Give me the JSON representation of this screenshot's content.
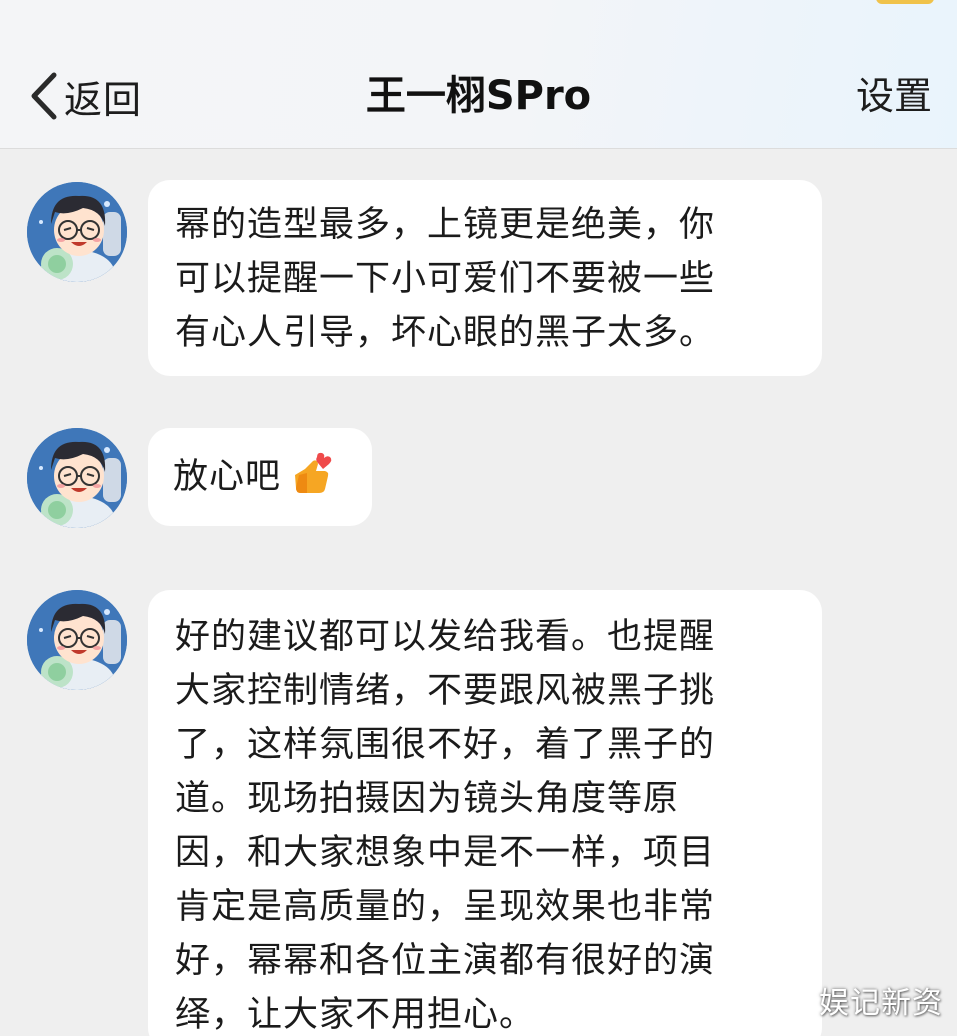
{
  "header": {
    "back_label": "返回",
    "title": "王一栩SPro",
    "settings_label": "设置"
  },
  "messages": [
    {
      "sender": "avatar",
      "text": "幂的造型最多，上镜更是绝美，你\n可以提醒一下小可爱们不要被一些\n有心人引导，坏心眼的黑子太多。"
    },
    {
      "sender": "avatar",
      "text": "放心吧",
      "emoji": "heart-thumbs-up-emoji-icon"
    },
    {
      "sender": "avatar",
      "text": "好的建议都可以发给我看。也提醒\n大家控制情绪，不要跟风被黑子挑\n了，这样氛围很不好，着了黑子的\n道。现场拍摄因为镜头角度等原\n因，和大家想象中是不一样，项目\n肯定是高质量的，呈现效果也非常\n好，幂幂和各位主演都有很好的演\n绎，让大家不用担心。"
    }
  ],
  "watermark": "娱记新资",
  "colors": {
    "page_background": "#efefef",
    "bubble_background": "#ffffff",
    "text": "#1b1b1b",
    "header_tint": "#e9f4fc"
  },
  "icons": {
    "back": "chevron-left-icon",
    "avatar": "cartoon-boy-avatar-icon"
  }
}
